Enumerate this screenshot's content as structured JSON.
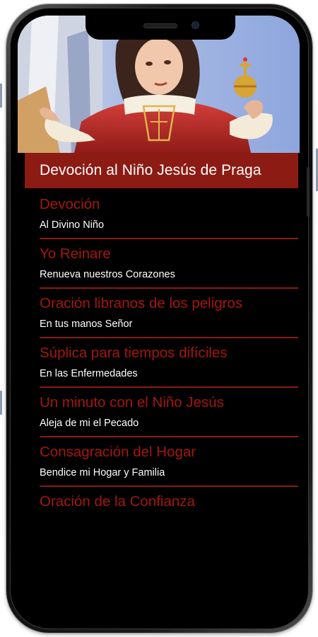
{
  "app": {
    "title": "Devoción al Niño Jesús de Praga"
  },
  "menu": {
    "items": [
      {
        "title": "Devoción",
        "subtitle": "Al Divino Niño"
      },
      {
        "title": "Yo Reinare",
        "subtitle": "Renueva nuestros Corazones"
      },
      {
        "title": "Oración libranos de los peligros",
        "subtitle": "En tus manos Señor"
      },
      {
        "title": "Súplica para tiempos difíciles",
        "subtitle": "En las Enfermedades"
      },
      {
        "title": "Un minuto con el Niño Jesús",
        "subtitle": "Aleja de mi el Pecado"
      },
      {
        "title": "Consagración del Hogar",
        "subtitle": "Bendice mi Hogar y Familia"
      },
      {
        "title": "Oración de la Confianza",
        "subtitle": ""
      }
    ]
  },
  "colors": {
    "accent": "#8c1b14",
    "heading_text": "#a3170f",
    "background": "#000000",
    "subtitle_text": "#ffffff"
  }
}
